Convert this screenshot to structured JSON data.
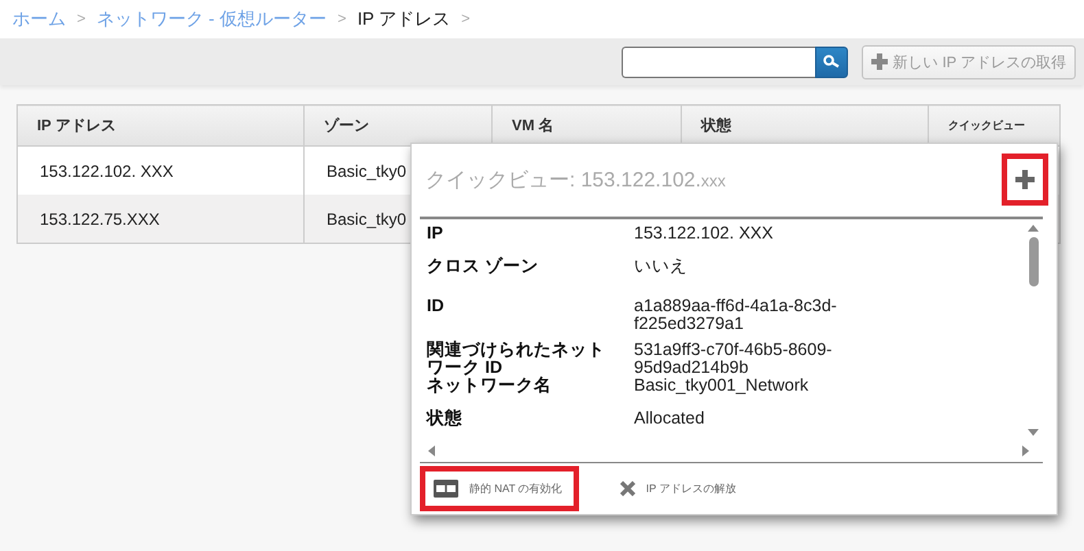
{
  "breadcrumb": [
    {
      "label": "ホーム",
      "link": true,
      "separator": ">"
    },
    {
      "label": "ネットワーク - 仮想ルーター",
      "link": true,
      "separator": ">"
    },
    {
      "label": "IP アドレス",
      "link": false,
      "separator": ">"
    }
  ],
  "toolbar": {
    "new_button": "新しい IP アドレスの取得"
  },
  "table": {
    "columns": [
      "IP アドレス",
      "ゾーン",
      "VM 名",
      "状態",
      "クイックビュー"
    ],
    "rows": [
      [
        "153.122.102. XXX",
        "Basic_tky0"
      ],
      [
        "153.122.75.XXX",
        "Basic_tky0"
      ]
    ]
  },
  "quick_view": {
    "title": "クイックビュー: 153.122.102.",
    "title_suffix": "xxx",
    "expand_highlighted": true,
    "details": [
      {
        "label": "IP",
        "value": "153.122.102. XXX"
      },
      {
        "label": "クロス ゾーン",
        "value": "いいえ"
      },
      {
        "label": "ID",
        "value": "a1a889aa-ff6d-4a1a-8c3d-f225ed3279a1"
      },
      {
        "label": "関連づけられたネットワーク ID",
        "value": "531a9ff3-c70f-46b5-8609-95d9ad214b9b"
      },
      {
        "label": "ネットワーク名",
        "value": "Basic_tky001_Network"
      },
      {
        "label": "状態",
        "value": "Allocated"
      }
    ],
    "actions": [
      {
        "kind": "nat",
        "label": "静的 NAT の有効化",
        "highlighted": true
      },
      {
        "kind": "release",
        "label": "IP アドレスの解放",
        "highlighted": false
      }
    ]
  }
}
